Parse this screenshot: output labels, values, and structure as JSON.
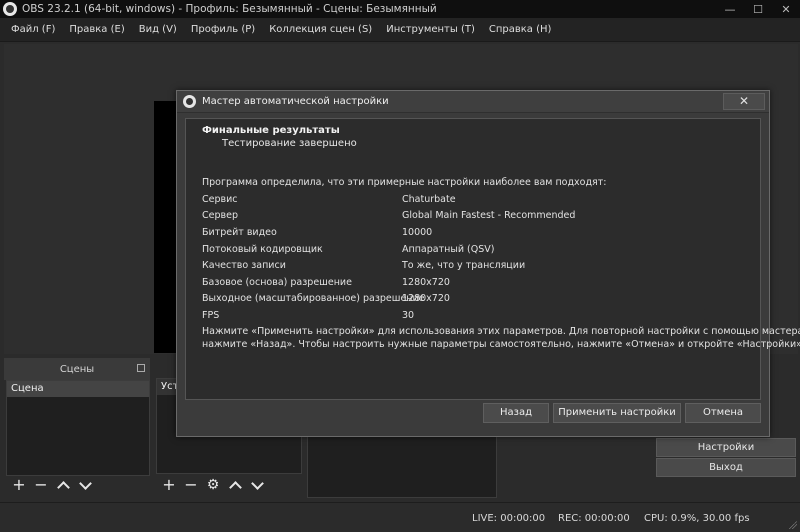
{
  "window": {
    "title": "OBS 23.2.1 (64-bit, windows) - Профиль: Безымянный - Сцены: Безымянный",
    "controls": {
      "minimize": "—",
      "maximize": "☐",
      "close": "✕"
    }
  },
  "menu": {
    "items": [
      "Файл (F)",
      "Правка (E)",
      "Вид (V)",
      "Профиль (P)",
      "Коллекция сцен (S)",
      "Инструменты (T)",
      "Справка (H)"
    ]
  },
  "scenes_dock": {
    "title": "Сцены",
    "items": [
      "Сцена"
    ]
  },
  "sources_dock": {
    "visible_title": "Уст"
  },
  "controls_dock": {
    "buttons": [
      "Настройки",
      "Выход"
    ]
  },
  "toolbar_icons": {
    "add": "+",
    "remove": "−",
    "settings": "⚙"
  },
  "status": {
    "live": "LIVE: 00:00:00",
    "rec": "REC: 00:00:00",
    "cpu": "CPU: 0.9%, 30.00 fps"
  },
  "wizard": {
    "title": "Мастер автоматической настройки",
    "close_label": "✕",
    "heading": "Финальные результаты",
    "subheading": "Тестирование завершено",
    "intro": "Программа определила, что эти примерные настройки наиболее вам подходят:",
    "results": [
      {
        "label": "Сервис",
        "value": "Chaturbate"
      },
      {
        "label": "Сервер",
        "value": "Global Main Fastest - Recommended"
      },
      {
        "label": "Битрейт видео",
        "value": "10000"
      },
      {
        "label": "Потоковый кодировщик",
        "value": "Аппаратный (QSV)"
      },
      {
        "label": "Качество записи",
        "value": "То же, что у трансляции"
      },
      {
        "label": "Базовое (основа) разрешение",
        "value": "1280x720"
      },
      {
        "label": "Выходное (масштабированное) разрешение",
        "value": "1280x720"
      },
      {
        "label": "FPS",
        "value": "30"
      }
    ],
    "note_line1": "Нажмите «Применить настройки» для использования этих параметров. Для повторной настройки с помощью мастера",
    "note_line2": "нажмите «Назад». Чтобы настроить нужные параметры самостоятельно, нажмите «Отмена» и откройте «Настройки».",
    "buttons": {
      "back": "Назад",
      "apply": "Применить настройки",
      "cancel": "Отмена"
    }
  }
}
